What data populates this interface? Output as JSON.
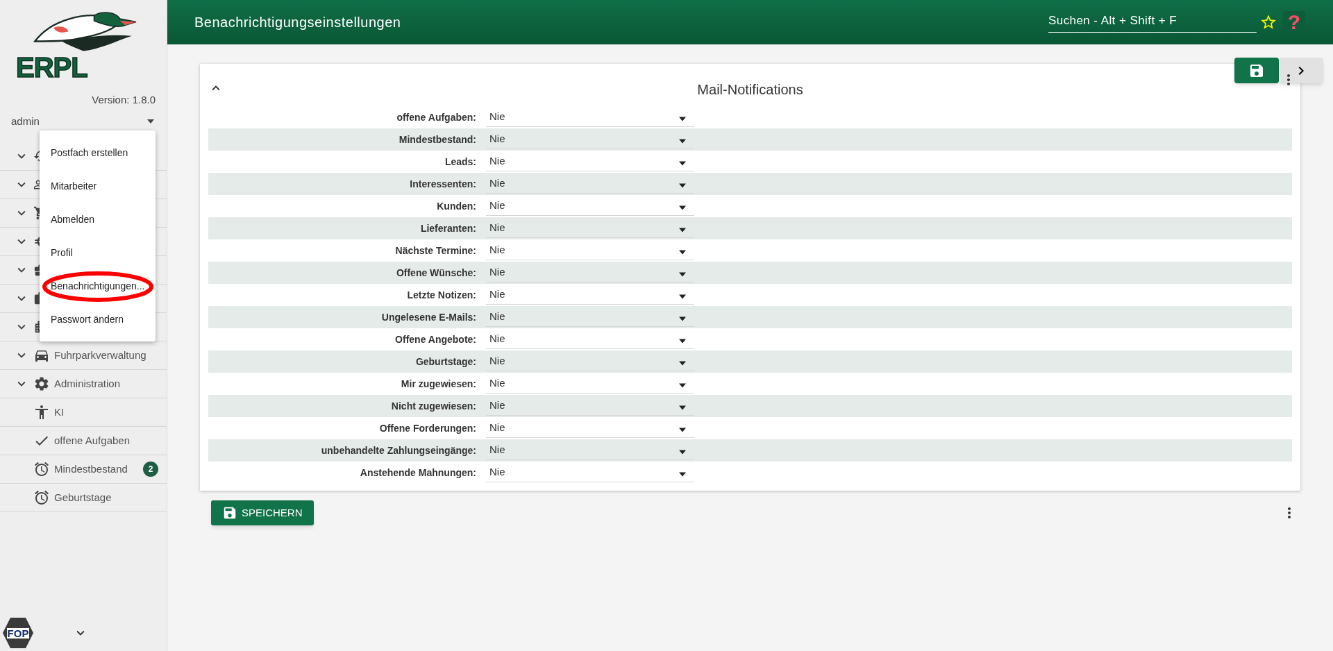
{
  "header": {
    "title": "Benachrichtigungseinstellungen",
    "search": {
      "placeholder": "Suchen - Alt + Shift + F"
    },
    "help": "?"
  },
  "sidebar": {
    "logo_text": "ERPL",
    "version": "Version: 1.8.0",
    "user": "admin",
    "user_menu": [
      {
        "label": "Postfach erstellen",
        "circled": false
      },
      {
        "label": "Mitarbeiter",
        "circled": false
      },
      {
        "label": "Abmelden",
        "circled": false
      },
      {
        "label": "Profil",
        "circled": false
      },
      {
        "label": "Benachrichtigungen...",
        "circled": true
      },
      {
        "label": "Passwort ändern",
        "circled": false
      }
    ],
    "nav_items": [
      {
        "kind": "group",
        "label": "Fuhrparkverwaltung"
      },
      {
        "kind": "group",
        "label": "Administration"
      },
      {
        "kind": "item",
        "label": "KI"
      },
      {
        "kind": "item",
        "label": "offene Aufgaben"
      },
      {
        "kind": "item",
        "label": "Mindestbestand",
        "badge": "2"
      },
      {
        "kind": "item",
        "label": "Geburtstage"
      }
    ],
    "footer_logo": "FOP"
  },
  "section": {
    "title": "Mail-Notifications",
    "expanded": true,
    "rows": [
      {
        "label": "offene Aufgaben:",
        "value": "Nie"
      },
      {
        "label": "Mindestbestand:",
        "value": "Nie"
      },
      {
        "label": "Leads:",
        "value": "Nie"
      },
      {
        "label": "Interessenten:",
        "value": "Nie"
      },
      {
        "label": "Kunden:",
        "value": "Nie"
      },
      {
        "label": "Lieferanten:",
        "value": "Nie"
      },
      {
        "label": "Nächste Termine:",
        "value": "Nie"
      },
      {
        "label": "Offene Wünsche:",
        "value": "Nie"
      },
      {
        "label": "Letzte Notizen:",
        "value": "Nie"
      },
      {
        "label": "Ungelesene E-Mails:",
        "value": "Nie"
      },
      {
        "label": "Offene Angebote:",
        "value": "Nie"
      },
      {
        "label": "Geburtstage:",
        "value": "Nie"
      },
      {
        "label": "Mir zugewiesen:",
        "value": "Nie"
      },
      {
        "label": "Nicht zugewiesen:",
        "value": "Nie"
      },
      {
        "label": "Offene Forderungen:",
        "value": "Nie"
      },
      {
        "label": "unbehandelte Zahlungseingänge:",
        "value": "Nie"
      },
      {
        "label": "Anstehende Mahnungen:",
        "value": "Nie"
      }
    ]
  },
  "save_button": "SPEICHERN"
}
